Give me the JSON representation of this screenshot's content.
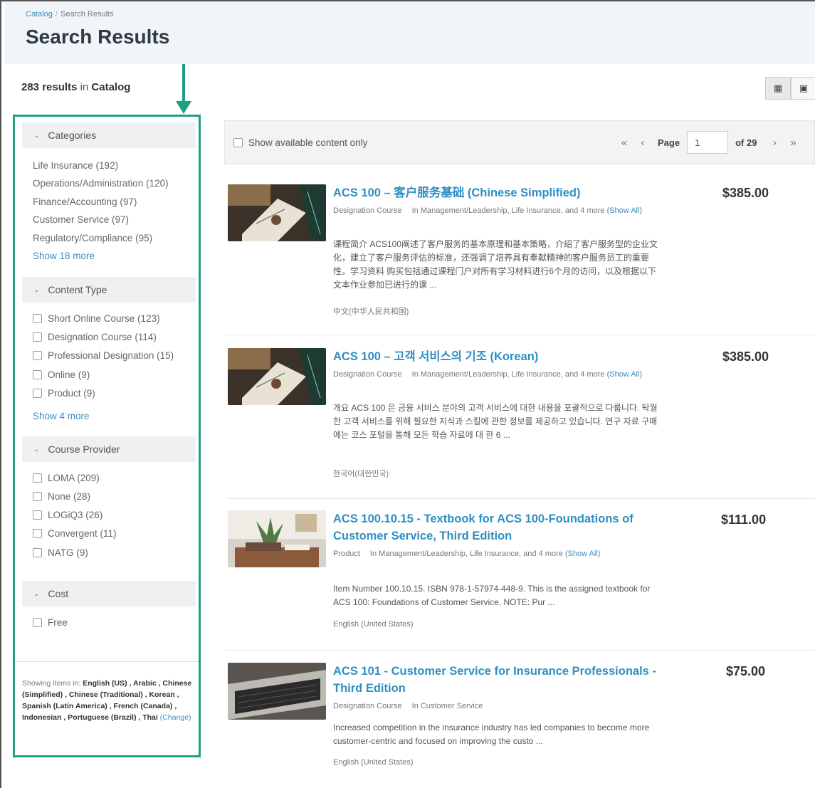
{
  "breadcrumb": {
    "catalog": "Catalog",
    "separator": "/",
    "current": "Search Results"
  },
  "page_title": "Search Results",
  "summary": {
    "count": "283 results",
    "in_text": "in",
    "scope": "Catalog"
  },
  "view_toggle": {
    "list_icon": "list-view-icon",
    "grid_icon": "calendar-view-icon"
  },
  "facets": {
    "categories": {
      "title": "Categories",
      "items": [
        "Life Insurance (192)",
        "Operations/Administration (120)",
        "Finance/Accounting (97)",
        "Customer Service (97)",
        "Regulatory/Compliance (95)"
      ],
      "show_more": "Show 18 more"
    },
    "content_type": {
      "title": "Content Type",
      "items": [
        "Short Online Course (123)",
        "Designation Course (114)",
        "Professional Designation (15)",
        "Online (9)",
        "Product (9)"
      ],
      "show_more": "Show 4 more"
    },
    "course_provider": {
      "title": "Course Provider",
      "items": [
        "LOMA (209)",
        "None (28)",
        "LOGiQ3 (26)",
        "Convergent (11)",
        "NATG (9)"
      ]
    },
    "cost": {
      "title": "Cost",
      "items": [
        "Free"
      ]
    }
  },
  "languages": {
    "prefix": "Showing items in:",
    "list": "English (US) , Arabic , Chinese (Simplified) , Chinese (Traditional) , Korean , Spanish (Latin America) , French (Canada) , Indonesian , Portuguese (Brazil) , Thai",
    "change": "(Change)"
  },
  "toolbar": {
    "available_only": "Show available content only",
    "page_label": "Page",
    "page_value": "1",
    "of_pages": "of 29"
  },
  "results": [
    {
      "title": "ACS 100 – 客户服务基础 (Chinese Simplified)",
      "price": "$385.00",
      "type": "Designation Course",
      "in_text": "In Management/Leadership, Life Insurance, and 4 more",
      "show_all": "(Show All)",
      "description": "课程简介 ACS100阐述了客户服务的基本原理和基本策略，介绍了客户服务型的企业文化，建立了客户服务评估的标准，还强调了培养具有奉献精神的客户服务员工的重要性。学习资料 购买包括通过课程门户对所有学习材料进行6个月的访问，以及根据以下文本作业参加已进行的课 ...",
      "language": "中文(中华人民共和国)"
    },
    {
      "title": "ACS 100 – 고객 서비스의 기조 (Korean)",
      "price": "$385.00",
      "type": "Designation Course",
      "in_text": "In Management/Leadership, Life Insurance, and 4 more",
      "show_all": "(Show All)",
      "description": "개요 ACS 100 은 금융 서비스 분야의 고객 서비스에 대한 내용을 포괄적으로 다룹니다. 탁월한 고객 서비스를 위해 필요한 지식과 스킬에 관한 정보를 제공하고 있습니다. 연구 자료 구매에는 코스 포털을 통해 모든 학습 자료에 대 한 6 ...",
      "language": "한국어(대한민국)"
    },
    {
      "title": "ACS 100.10.15 - Textbook for ACS 100-Foundations of Customer Service, Third Edition",
      "price": "$111.00",
      "type": "Product",
      "in_text": "In Management/Leadership, Life Insurance, and 4 more",
      "show_all": "(Show All)",
      "description": "Item Number 100.10.15. ISBN 978-1-57974-448-9. This is the assigned textbook for ACS 100: Foundations of Customer Service. NOTE: Pur ...",
      "language": "English (United States)"
    },
    {
      "title": "ACS 101 - Customer Service for Insurance Professionals - Third Edition",
      "price": "$75.00",
      "type": "Designation Course",
      "in_text": "In Customer Service",
      "show_all": "",
      "description": "Increased competition in the insurance industry has led companies to become more customer-centric and focused on improving the custo ...",
      "language": "English (United States)"
    }
  ],
  "colors": {
    "accent": "#2d8fc2",
    "highlight_border": "#1e9e82",
    "header_bg": "#f1f5f8"
  }
}
